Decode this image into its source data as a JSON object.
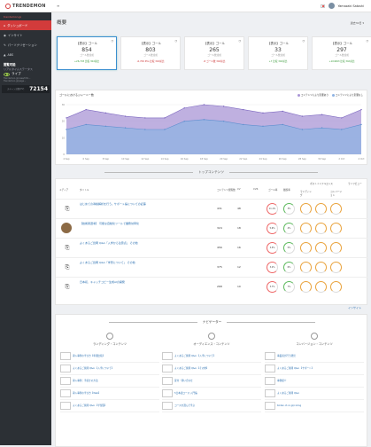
{
  "header": {
    "logo": "TRENDEMON",
    "user": "Yamazaki Satoshi"
  },
  "sidebar": {
    "site": "trendemon.jp",
    "items": [
      {
        "label": "ダッシュボード"
      },
      {
        "label": "インサイト"
      },
      {
        "label": "パーソナリゼーション"
      },
      {
        "label": "ABS"
      }
    ],
    "section": "閲覧可能",
    "sub": "リアルタイムステータス",
    "live": "ライブ",
    "live_note1": "Trendemon.jp/case/htm...",
    "live_note2": "Trendemon.jp/page...",
    "count_label": "スキャン済数(PV)",
    "count": "72154"
  },
  "main": {
    "title": "概要",
    "period": "過去30日"
  },
  "cards": [
    {
      "label": "【表示】ゴール",
      "value": "854",
      "unit": "ゴール数達成",
      "delta": "+26,793 比較 30d前比",
      "trend": "up"
    },
    {
      "label": "【表示】ゴール",
      "value": "803",
      "unit": "ゴール数達成",
      "delta": "-6,709 PVs 比較 30d前比",
      "trend": "dn"
    },
    {
      "label": "【表示】ゴール",
      "value": "265",
      "unit": "ゴール数達成",
      "delta": "-8 ゴール数 30d前比",
      "trend": "dn"
    },
    {
      "label": "【表示】ゴール",
      "value": "33",
      "unit": "ゴール数達成",
      "delta": "+7 比較 30d前比",
      "trend": "up"
    },
    {
      "label": "【表示】ゴール",
      "value": "297",
      "unit": "ゴール数達成",
      "delta": "+104693 比較 30d前比",
      "trend": "up"
    }
  ],
  "chart": {
    "title": "ゴールにおけるジャーニー数",
    "legend": [
      "コンテンツにより影響あり",
      "コンテンツにより影響なし"
    ],
    "colors": [
      "#a995d6",
      "#8fb3e3"
    ]
  },
  "chart_data": {
    "type": "area",
    "x": [
      "4 Sep",
      "6 Sep",
      "8 Sep",
      "10 Sep",
      "12 Sep",
      "14 Sep",
      "16 Sep",
      "18 Sep",
      "20 Sep",
      "22 Sep",
      "24 Sep",
      "26 Sep",
      "28 Sep",
      "30 Sep",
      "2 Oct",
      "4 Oct"
    ],
    "series": [
      {
        "name": "コンテンツにより影響あり",
        "values": [
          22,
          27,
          25,
          23,
          22,
          22,
          28,
          30,
          29,
          27,
          25,
          26,
          23,
          24,
          22,
          27
        ]
      },
      {
        "name": "コンテンツにより影響なし",
        "values": [
          15,
          18,
          17,
          16,
          15,
          15,
          20,
          21,
          20,
          18,
          17,
          18,
          15,
          16,
          15,
          18
        ]
      }
    ],
    "ylim": [
      0,
      30
    ],
    "yticks": [
      0,
      10,
      20,
      30
    ]
  },
  "top": {
    "title": "トップコンテンツ",
    "headers": [
      "メディア",
      "タイトル",
      "コンテンツ閲覧数",
      "CV",
      "CVR",
      "ゴール率",
      "離脱率",
      "ランディング",
      "ポストインフルエンス",
      "コンバージョン",
      "ライフビュー"
    ],
    "rows": [
      {
        "title": "はじめての導線解析を行う。サポート編についての記事",
        "a": "431",
        "b": "48",
        "c": "11.1%",
        "d": "3%"
      },
      {
        "title": "【技術者選考】 可能な自動化ツールで業務効率化",
        "a": "324",
        "b": "18",
        "c": "5.6%",
        "d": "4%"
      },
      {
        "title": "よくあるご質問 Q&A「入学から注意点」 その他",
        "a": "456",
        "b": "16",
        "c": "3.5%",
        "d": "5%"
      },
      {
        "title": "よくあるご質問 Q&A「学習について」 その他",
        "a": "375",
        "b": "12",
        "c": "3.2%",
        "d": "6%"
      },
      {
        "title": "日本初、キャッチコピー生成AIの開発",
        "a": "268",
        "b": "10",
        "c": "3.7%",
        "d": "7%"
      }
    ],
    "more": "インサイト"
  },
  "navigator": {
    "title": "ナビゲーター",
    "columns": [
      {
        "title": "ランディング・コンテンツ",
        "items": [
          "導入事例の学び方【年間比較】",
          "よくあるご質問 Q&A 【入学について】",
          "導入事例：手続きの方法",
          "導入事例の学び方【Web】",
          "よくあるご質問 Q&A 【学習面】"
        ]
      },
      {
        "title": "オーディエンス・コンテンツ",
        "items": [
          "よくあるご質問 Q&A 【入学について】",
          "よくあるご質問 Q&A 【その他】",
          "受付・問い合わせ",
          "5日本語コース 入門編",
          "コースを選んで学ぶ"
        ]
      },
      {
        "title": "コンバージョン・コンテンツ",
        "items": [
          "事業者が行う経営",
          "よくあるご質問 Q&A 【サポート】",
          "事例紹介",
          "よくあるご質問 Q&A",
          "Kodan.ct.co.jp/c-blog"
        ]
      }
    ]
  }
}
